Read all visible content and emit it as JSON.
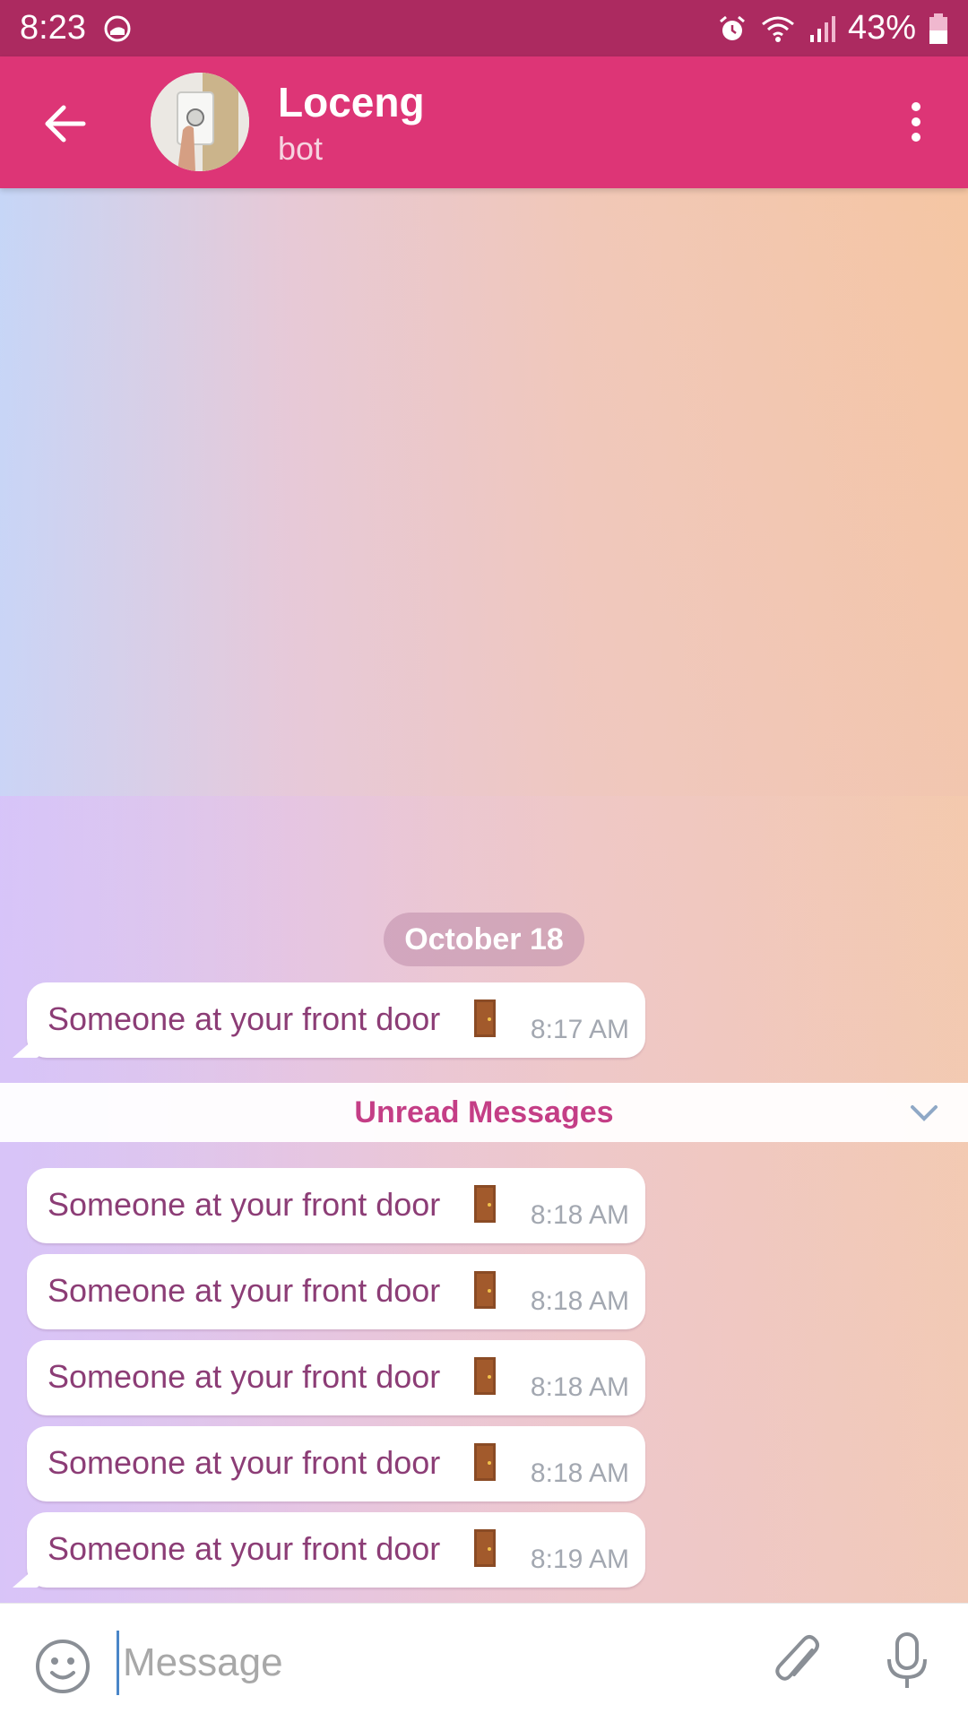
{
  "status_bar": {
    "time": "8:23",
    "battery": "43%",
    "icons": [
      "app-notification-icon",
      "alarm-icon",
      "wifi-icon",
      "signal-icon",
      "battery-icon"
    ]
  },
  "header": {
    "title": "Loceng",
    "subtitle": "bot",
    "back_icon": "arrow-left-icon",
    "menu_icon": "more-vertical-icon",
    "colors": {
      "header": "#dd3576",
      "status_bar": "#ac2a60"
    }
  },
  "chat": {
    "date_chip": "October 18",
    "unread_label": "Unread Messages",
    "messages": [
      {
        "text": "Someone at your front door",
        "emoji": "door-icon",
        "time": "8:17 AM"
      },
      {
        "text": "Someone at your front door",
        "emoji": "door-icon",
        "time": "8:18 AM"
      },
      {
        "text": "Someone at your front door",
        "emoji": "door-icon",
        "time": "8:18 AM"
      },
      {
        "text": "Someone at your front door",
        "emoji": "door-icon",
        "time": "8:18 AM"
      },
      {
        "text": "Someone at your front door",
        "emoji": "door-icon",
        "time": "8:18 AM"
      },
      {
        "text": "Someone at your front door",
        "emoji": "door-icon",
        "time": "8:19 AM"
      }
    ]
  },
  "input": {
    "placeholder": "Message",
    "value": "",
    "icons": [
      "emoji-smile-icon",
      "paperclip-icon",
      "microphone-icon"
    ]
  }
}
